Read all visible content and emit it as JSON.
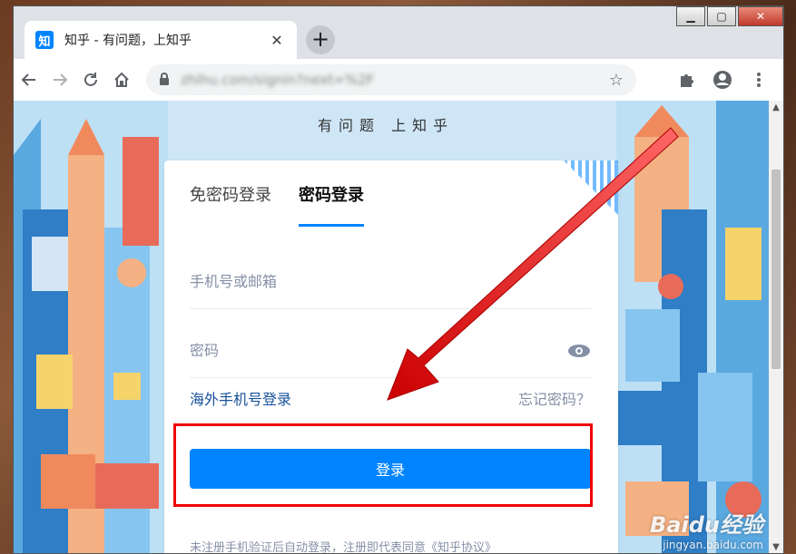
{
  "browser": {
    "tab_favicon": "知",
    "tab_title": "知乎 - 有问题，上知乎",
    "tab_close": "✕",
    "new_tab": "+",
    "url": "zhihu.com/signin?next=%2F",
    "window_controls": {
      "minimize": "▁",
      "maximize": "▢",
      "close": "✕"
    }
  },
  "page": {
    "slogan": "有问题 上知乎",
    "tabs": [
      {
        "label": "免密码登录",
        "active": false
      },
      {
        "label": "密码登录",
        "active": true
      }
    ],
    "phone_placeholder": "手机号或邮箱",
    "password_placeholder": "密码",
    "overseas_link": "海外手机号登录",
    "forgot_link": "忘记密码？",
    "login_button": "登录",
    "notice": "未注册手机验证后自动登录，注册即代表同意《知乎协议》"
  },
  "watermark": {
    "logo": "Baidu经验",
    "url": "jingyan.baidu.com"
  },
  "colors": {
    "accent": "#0084ff",
    "highlight": "#e00000",
    "arrow": "#e00000"
  }
}
